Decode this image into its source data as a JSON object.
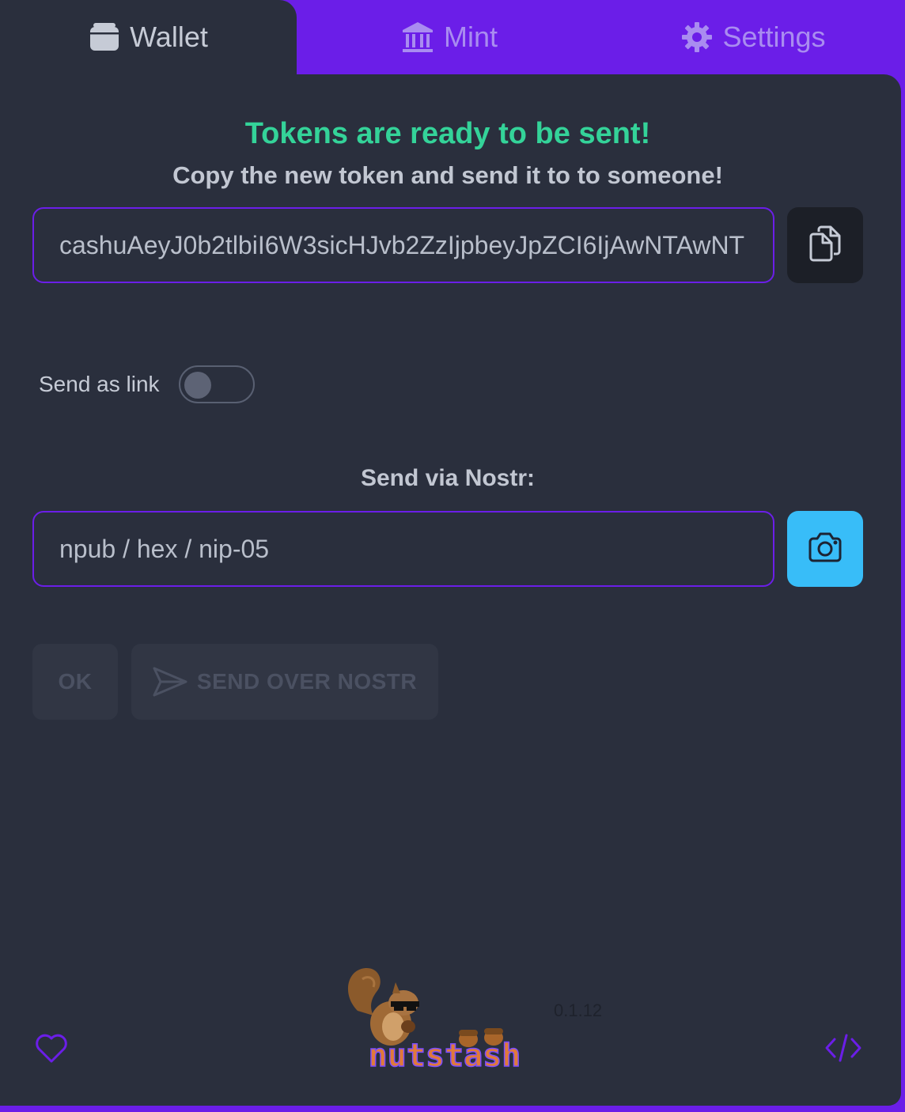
{
  "tabs": [
    {
      "label": "Wallet",
      "icon": "wallet-icon",
      "active": true
    },
    {
      "label": "Mint",
      "icon": "bank-icon",
      "active": false
    },
    {
      "label": "Settings",
      "icon": "gear-icon",
      "active": false
    }
  ],
  "send": {
    "title": "Tokens are ready to be sent!",
    "subtitle": "Copy the new token and send it to to someone!",
    "token_value": "cashuAeyJ0b2tlbiI6W3sicHJvb2ZzIjpbeyJpZCI6IjAwNTAwNT",
    "copy_icon": "copy-icon",
    "send_as_link_label": "Send as link",
    "send_as_link_enabled": false,
    "nostr_label": "Send via Nostr:",
    "nostr_placeholder": "npub / hex / nip-05",
    "camera_icon": "camera-icon",
    "ok_label": "OK",
    "send_over_nostr_label": "SEND OVER NOSTR"
  },
  "footer": {
    "logo_text": "nutstash",
    "version": "0.1.12",
    "heart_icon": "heart-icon",
    "code_icon": "code-icon"
  },
  "colors": {
    "accent": "#6b1ee8",
    "success": "#34d399",
    "panel": "#2a2f3d",
    "camera_button": "#38bdf8"
  }
}
